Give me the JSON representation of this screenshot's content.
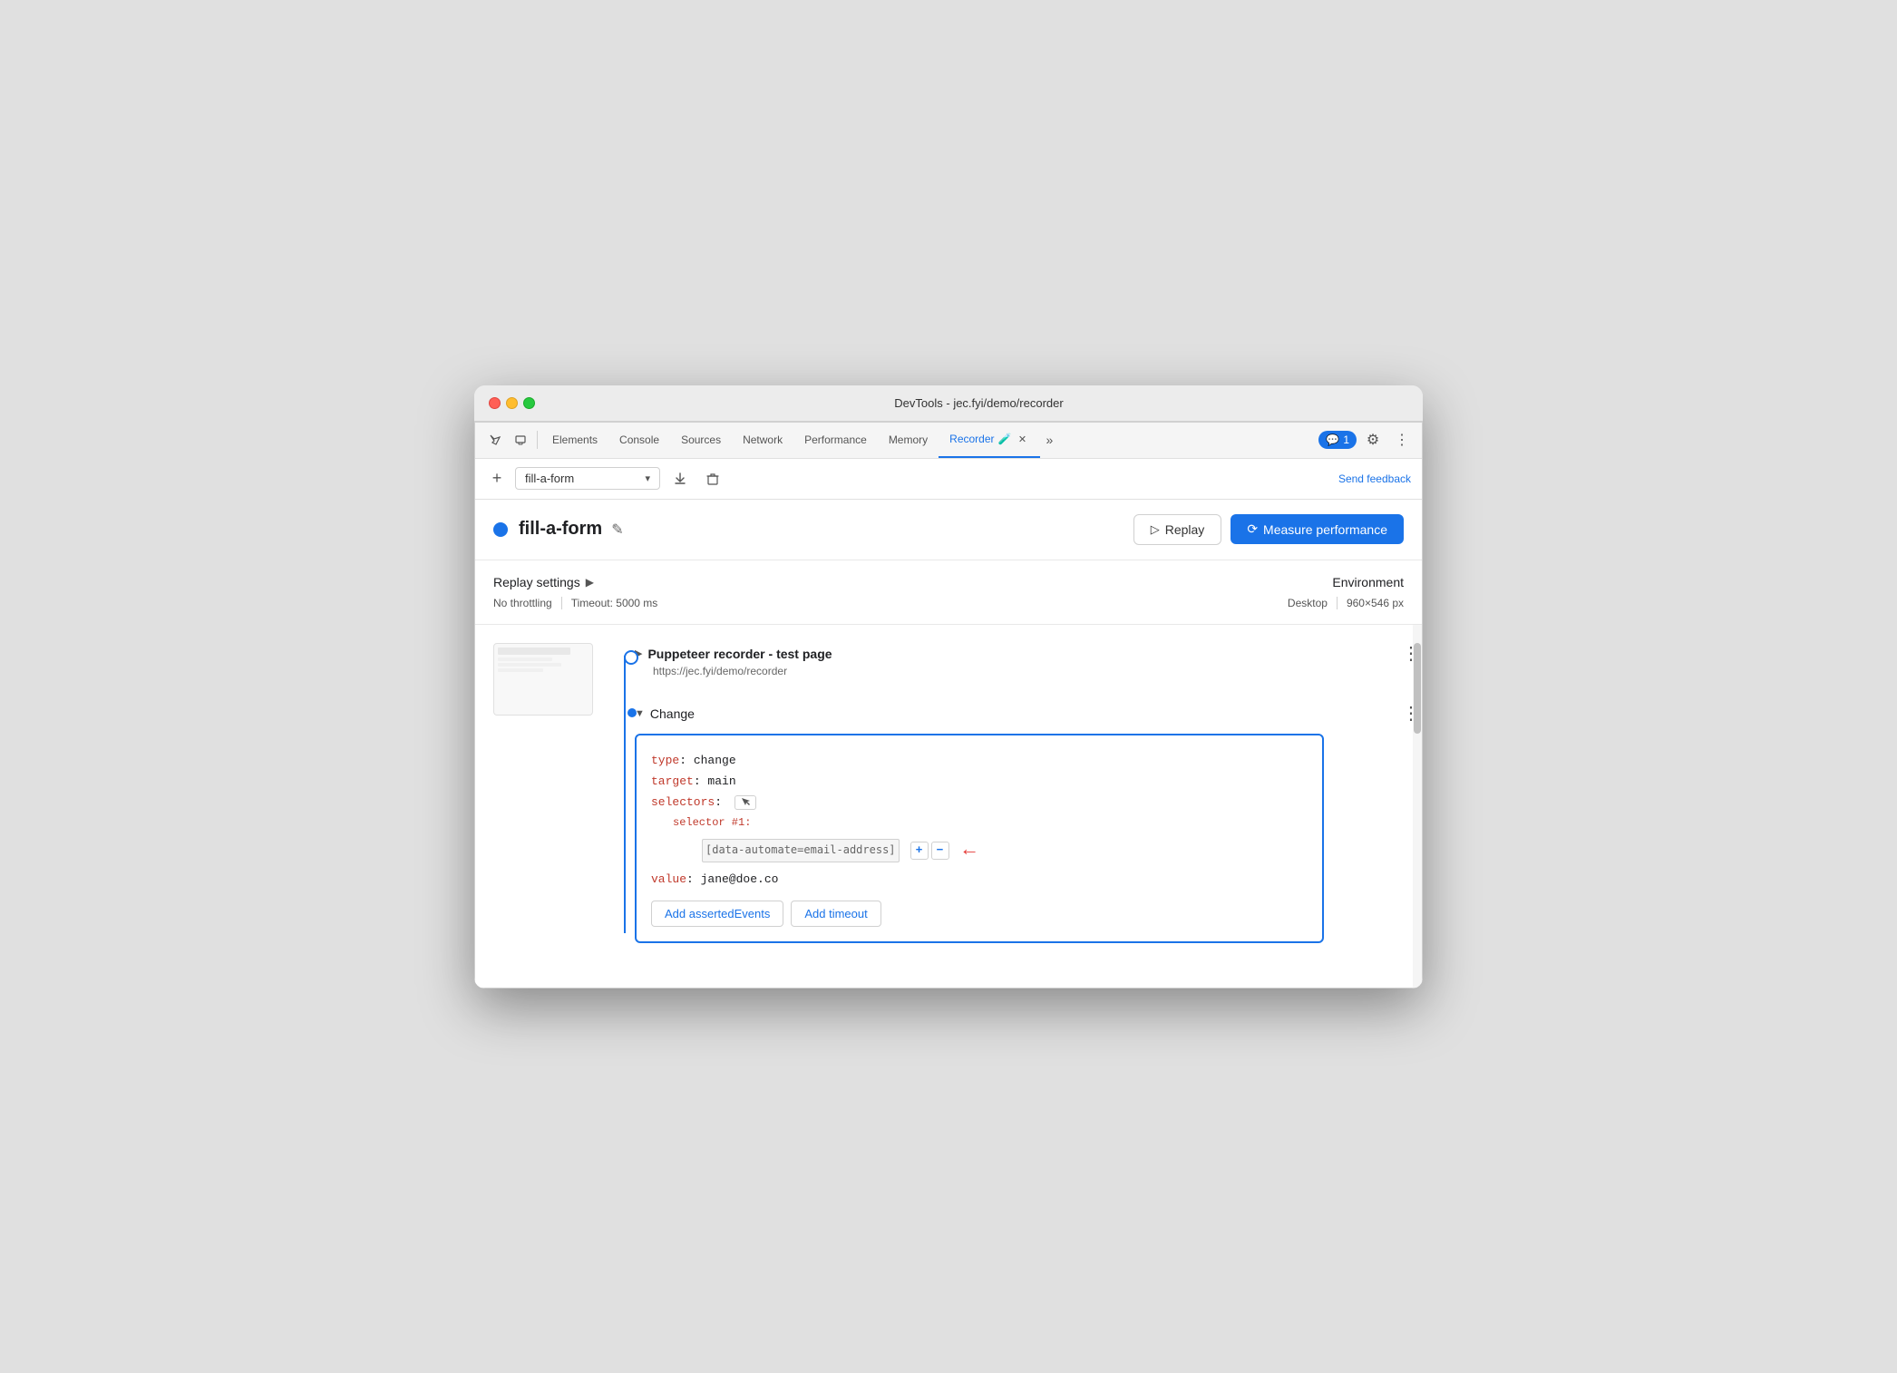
{
  "window": {
    "title": "DevTools - jec.fyi/demo/recorder"
  },
  "tabs": {
    "items": [
      {
        "id": "elements",
        "label": "Elements"
      },
      {
        "id": "console",
        "label": "Console"
      },
      {
        "id": "sources",
        "label": "Sources"
      },
      {
        "id": "network",
        "label": "Network"
      },
      {
        "id": "performance",
        "label": "Performance"
      },
      {
        "id": "memory",
        "label": "Memory"
      },
      {
        "id": "recorder",
        "label": "Recorder",
        "active": true
      }
    ],
    "notification": "1",
    "more_label": "»"
  },
  "toolbar": {
    "add_label": "+",
    "recording_name": "fill-a-form",
    "download_icon": "⬇",
    "delete_icon": "🗑",
    "send_feedback": "Send feedback"
  },
  "recording": {
    "dot_color": "#1a73e8",
    "name": "fill-a-form",
    "edit_icon": "✎",
    "replay_label": "Replay",
    "measure_label": "Measure performance"
  },
  "settings": {
    "replay_settings_label": "Replay settings",
    "throttling_label": "No throttling",
    "timeout_label": "Timeout: 5000 ms",
    "environment_label": "Environment",
    "desktop_label": "Desktop",
    "resolution_label": "960×546 px"
  },
  "steps": {
    "step1": {
      "title": "Puppeteer recorder - test page",
      "url": "https://jec.fyi/demo/recorder",
      "more_icon": "⋮"
    },
    "step2": {
      "title": "Change",
      "more_icon": "⋮",
      "code": {
        "type_key": "type",
        "type_val": "change",
        "target_key": "target",
        "target_val": "main",
        "selectors_key": "selectors",
        "selector_num_label": "selector #1:",
        "selector_value": "[data-automate=email-address]",
        "value_key": "value",
        "value_val": "jane@doe.co"
      },
      "add_asserted_label": "Add assertedEvents",
      "add_timeout_label": "Add timeout",
      "add_btn_label": "+",
      "remove_btn_label": "−"
    }
  }
}
